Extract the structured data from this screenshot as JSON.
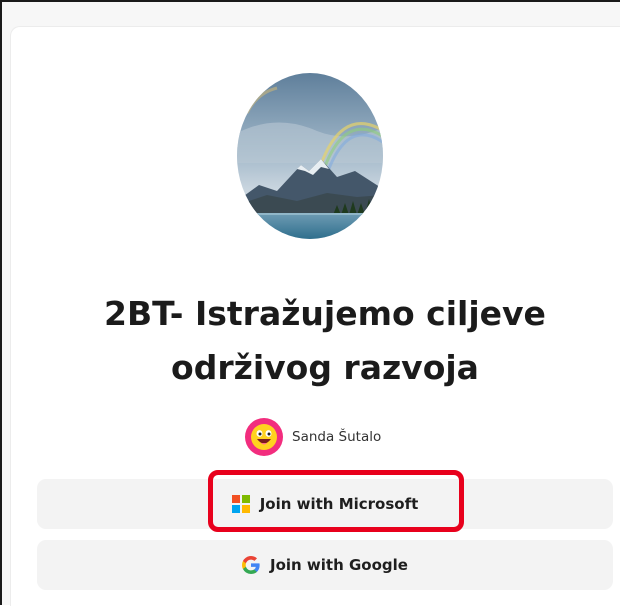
{
  "quiz": {
    "title": "2BT- Istražujemo ciljeve održivog razvoja",
    "cover_image": "mountain-lake-rainbow-photo"
  },
  "author": {
    "name": "Sanda Šutalo",
    "avatar_icon": "smiley-face-icon",
    "avatar_color": "#f22d7e"
  },
  "buttons": {
    "microsoft_label": "Join with Microsoft",
    "microsoft_icon": "microsoft-logo-icon",
    "google_label": "Join with Google",
    "google_icon": "google-logo-icon"
  },
  "annotation": {
    "highlight_color": "#e8001c"
  }
}
